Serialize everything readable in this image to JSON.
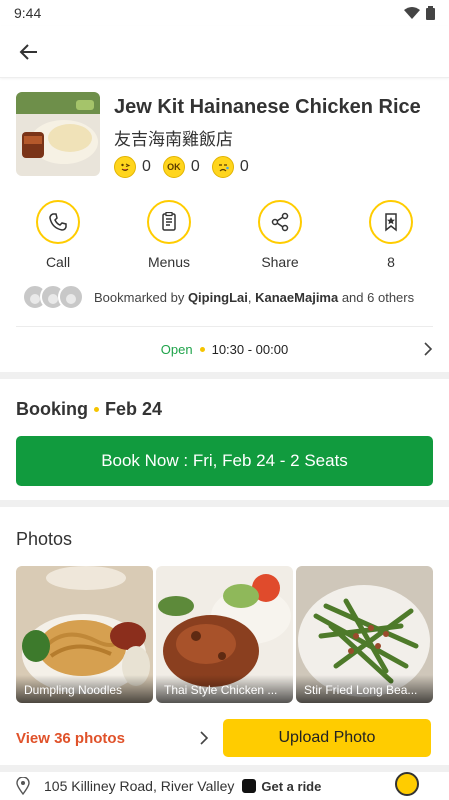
{
  "status": {
    "time": "9:44"
  },
  "restaurant": {
    "name": "Jew Kit Hainanese Chicken Rice",
    "name_cjk": "友吉海南雞飯店",
    "reactions": [
      {
        "icon": "yum-face-icon",
        "count": "0"
      },
      {
        "icon": "ok-face-icon",
        "count": "0"
      },
      {
        "icon": "sad-face-icon",
        "count": "0"
      }
    ]
  },
  "actions": [
    {
      "label": "Call",
      "icon": "phone-icon"
    },
    {
      "label": "Menus",
      "icon": "menu-icon"
    },
    {
      "label": "Share",
      "icon": "share-icon"
    },
    {
      "label": "8",
      "icon": "bookmark-icon"
    }
  ],
  "bookmarked": {
    "prefix": "Bookmarked by ",
    "user1": "QipingLai",
    "sep": ", ",
    "user2": "KanaeMajima",
    "suffix": " and 6 others"
  },
  "hours": {
    "status": "Open",
    "time": "10:30 - 00:00"
  },
  "booking": {
    "title": "Booking",
    "date": "Feb 24",
    "button_label": "Book Now : Fri, Feb 24 - 2 Seats"
  },
  "photos": {
    "title": "Photos",
    "items": [
      {
        "caption": "Dumpling Noodles"
      },
      {
        "caption": "Thai Style Chicken ..."
      },
      {
        "caption": "Stir Fried Long Bea..."
      }
    ],
    "view_label": "View 36 photos",
    "upload_label": "Upload Photo"
  },
  "address": {
    "text": "105 Killiney Road, River Valley",
    "ride_label": "Get a ride"
  },
  "colors": {
    "accent": "#ffcc00",
    "book_green": "#119b3e",
    "open_green": "#1fa34a",
    "view_orange": "#e0522a"
  }
}
